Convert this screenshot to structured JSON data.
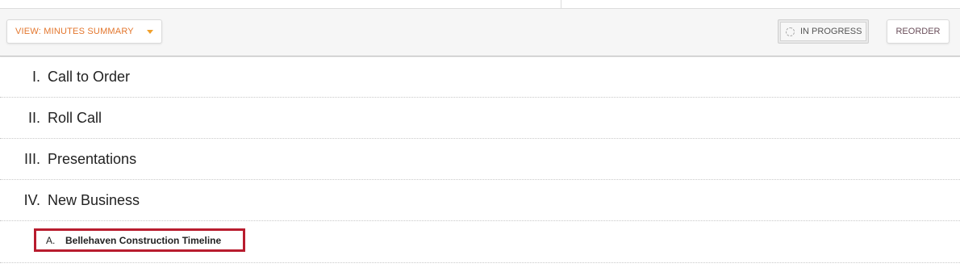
{
  "toolbar": {
    "view_label": "VIEW: MINUTES SUMMARY",
    "status_label": "IN PROGRESS",
    "reorder_label": "REORDER"
  },
  "agenda": {
    "items": [
      {
        "number": "I.",
        "title": "Call to Order"
      },
      {
        "number": "II.",
        "title": "Roll Call"
      },
      {
        "number": "III.",
        "title": "Presentations"
      },
      {
        "number": "IV.",
        "title": "New Business"
      }
    ],
    "subitems": [
      {
        "letter": "A.",
        "title": "Bellehaven Construction Timeline"
      }
    ]
  },
  "colors": {
    "accent_orange": "#e3762d",
    "highlight_red": "#b81c2e"
  }
}
